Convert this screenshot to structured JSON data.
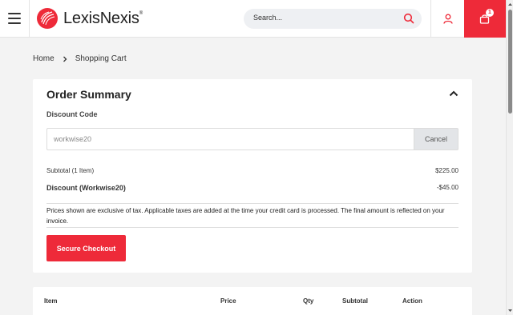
{
  "header": {
    "logo_text": "LexisNexis",
    "logo_mark": "®",
    "search_placeholder": "Search...",
    "cart_count": "1"
  },
  "icons": {
    "menu": "hamburger-icon",
    "logo": "lexisnexis-logo-icon",
    "search": "search-icon",
    "user": "user-icon",
    "cart": "shopping-bag-icon",
    "collapse": "chevron-up-icon",
    "breadcrumb_sep": "chevron-right-icon"
  },
  "colors": {
    "accent": "#ee2a39",
    "page_bg": "#f3f3f3",
    "cancel_bg": "#e3e5e8"
  },
  "breadcrumb": {
    "home": "Home",
    "current": "Shopping Cart"
  },
  "order_summary": {
    "title": "Order Summary",
    "discount_label": "Discount Code",
    "discount_value": "workwise20",
    "cancel_label": "Cancel",
    "subtotal_label": "Subtotal (1 Item)",
    "subtotal_value": "$225.00",
    "discount_row_label": "Discount (Workwise20)",
    "discount_row_value": "-$45.00",
    "tax_note": "Prices shown are exclusive of tax. Applicable taxes are added at the time your credit card is processed. The final amount is reflected on your invoice.",
    "checkout_label": "Secure Checkout"
  },
  "cart_table": {
    "columns": [
      "Item",
      "Price",
      "Qty",
      "Subtotal",
      "Action"
    ]
  }
}
